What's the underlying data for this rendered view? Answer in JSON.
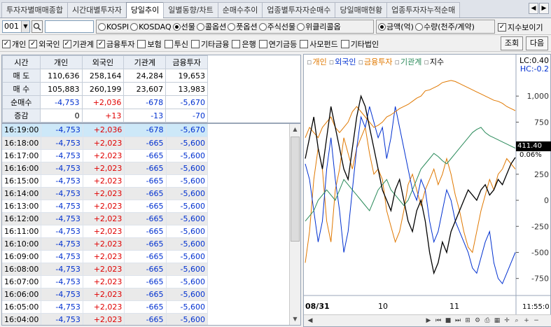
{
  "tabs": [
    {
      "label": "투자자별매매종합",
      "active": false
    },
    {
      "label": "시간대별투자자",
      "active": false
    },
    {
      "label": "당일추이",
      "active": true
    },
    {
      "label": "일별동향/차트",
      "active": false
    },
    {
      "label": "순매수추이",
      "active": false
    },
    {
      "label": "업종별투자자순매수",
      "active": false
    },
    {
      "label": "당일매매현황",
      "active": false
    },
    {
      "label": "업종투자자누적순매",
      "active": false
    }
  ],
  "filters": {
    "code": "001",
    "markets": [
      {
        "label": "KOSPI",
        "selected": false
      },
      {
        "label": "KOSDAQ",
        "selected": false
      },
      {
        "label": "선물",
        "selected": true
      },
      {
        "label": "콜옵션",
        "selected": false
      },
      {
        "label": "풋옵션",
        "selected": false
      },
      {
        "label": "주식선물",
        "selected": false
      },
      {
        "label": "위클리콜옵",
        "selected": false
      }
    ],
    "units": [
      {
        "label": "금액(억)",
        "selected": true
      },
      {
        "label": "수량(천주/계약)",
        "selected": false
      }
    ],
    "show_index_label": "지수보이기",
    "investors": [
      {
        "label": "개인",
        "checked": true
      },
      {
        "label": "외국인",
        "checked": true
      },
      {
        "label": "기관계",
        "checked": true
      },
      {
        "label": "금융투자",
        "checked": true
      },
      {
        "label": "보험",
        "checked": false
      },
      {
        "label": "투신",
        "checked": false
      },
      {
        "label": "기타금융",
        "checked": false
      },
      {
        "label": "은행",
        "checked": false
      },
      {
        "label": "연기금등",
        "checked": false
      },
      {
        "label": "사모펀드",
        "checked": false
      },
      {
        "label": "기타법인",
        "checked": false
      }
    ],
    "query_button": "조회",
    "next_button": "다음"
  },
  "summary": {
    "headers": [
      "시간",
      "개인",
      "외국인",
      "기관계",
      "금융투자"
    ],
    "rows": [
      {
        "label": "매 도",
        "values": [
          "110,636",
          "258,164",
          "24,284",
          "19,653"
        ],
        "color": [
          "",
          "",
          "",
          ""
        ]
      },
      {
        "label": "매 수",
        "values": [
          "105,883",
          "260,199",
          "23,607",
          "13,983"
        ],
        "color": [
          "",
          "",
          "",
          ""
        ]
      },
      {
        "label": "순매수",
        "values": [
          "-4,753",
          "+2,036",
          "-678",
          "-5,670"
        ],
        "color": [
          "blue",
          "red",
          "blue",
          "blue"
        ]
      },
      {
        "label": "증감",
        "values": [
          "0",
          "+13",
          "-13",
          "-70"
        ],
        "color": [
          "",
          "red",
          "blue",
          "blue"
        ]
      }
    ]
  },
  "timeline": [
    {
      "time": "16:19:00",
      "v": [
        "-4,753",
        "+2,036",
        "-678",
        "-5,670"
      ]
    },
    {
      "time": "16:18:00",
      "v": [
        "-4,753",
        "+2,023",
        "-665",
        "-5,600"
      ]
    },
    {
      "time": "16:17:00",
      "v": [
        "-4,753",
        "+2,023",
        "-665",
        "-5,600"
      ]
    },
    {
      "time": "16:16:00",
      "v": [
        "-4,753",
        "+2,023",
        "-665",
        "-5,600"
      ]
    },
    {
      "time": "16:15:00",
      "v": [
        "-4,753",
        "+2,023",
        "-665",
        "-5,600"
      ]
    },
    {
      "time": "16:14:00",
      "v": [
        "-4,753",
        "+2,023",
        "-665",
        "-5,600"
      ]
    },
    {
      "time": "16:13:00",
      "v": [
        "-4,753",
        "+2,023",
        "-665",
        "-5,600"
      ]
    },
    {
      "time": "16:12:00",
      "v": [
        "-4,753",
        "+2,023",
        "-665",
        "-5,600"
      ]
    },
    {
      "time": "16:11:00",
      "v": [
        "-4,753",
        "+2,023",
        "-665",
        "-5,600"
      ]
    },
    {
      "time": "16:10:00",
      "v": [
        "-4,753",
        "+2,023",
        "-665",
        "-5,600"
      ]
    },
    {
      "time": "16:09:00",
      "v": [
        "-4,753",
        "+2,023",
        "-665",
        "-5,600"
      ]
    },
    {
      "time": "16:08:00",
      "v": [
        "-4,753",
        "+2,023",
        "-665",
        "-5,600"
      ]
    },
    {
      "time": "16:07:00",
      "v": [
        "-4,753",
        "+2,023",
        "-665",
        "-5,600"
      ]
    },
    {
      "time": "16:06:00",
      "v": [
        "-4,753",
        "+2,023",
        "-665",
        "-5,600"
      ]
    },
    {
      "time": "16:05:00",
      "v": [
        "-4,753",
        "+2,023",
        "-665",
        "-5,600"
      ]
    },
    {
      "time": "16:04:00",
      "v": [
        "-4,753",
        "+2,023",
        "-665",
        "-5,600"
      ]
    }
  ],
  "chart": {
    "legend": [
      {
        "label": "개인",
        "color": "#e07800"
      },
      {
        "label": "외국인",
        "color": "#0030d0"
      },
      {
        "label": "금융투자",
        "color": "#e07800"
      },
      {
        "label": "기관계",
        "color": "#2a8a5a"
      },
      {
        "label": "지수",
        "color": "#000000"
      }
    ],
    "lc_label": "LC:0.40",
    "hc_label": "HC:-0.2",
    "y_ticks": [
      "1,000",
      "750",
      "500",
      "250",
      "0",
      "-250",
      "-500",
      "-750"
    ],
    "current_value": "411.40",
    "current_pct": "0.06%",
    "x_labels": [
      "08/31",
      "10",
      "11",
      "11:55:0"
    ]
  },
  "chart_data": {
    "type": "line",
    "title": "",
    "ylim": [
      -900,
      1250
    ],
    "y_ticks": [
      1000,
      750,
      500,
      250,
      0,
      -250,
      -500,
      -750
    ],
    "x_labels": [
      "08/31",
      "10",
      "11"
    ],
    "series": [
      {
        "name": "개인",
        "color": "#e07800",
        "values": [
          -600,
          -300,
          200,
          500,
          300,
          -200,
          -400,
          100,
          300,
          600,
          450,
          300,
          500,
          600,
          700,
          450,
          250,
          300,
          200,
          -100,
          -250,
          -400,
          -300,
          -100,
          150,
          250,
          100,
          -50,
          100,
          200,
          300,
          150,
          250,
          400,
          250,
          50,
          -100,
          -300,
          -450,
          -500,
          -300,
          -100,
          50,
          200,
          100,
          250,
          300,
          400,
          350,
          300
        ]
      },
      {
        "name": "외국인",
        "color": "#0030d0",
        "values": [
          350,
          200,
          -100,
          -400,
          -200,
          300,
          600,
          200,
          -100,
          -500,
          -300,
          100,
          500,
          800,
          700,
          900,
          750,
          600,
          700,
          400,
          600,
          900,
          700,
          500,
          300,
          100,
          0,
          200,
          100,
          -200,
          -400,
          -300,
          -100,
          100,
          0,
          -200,
          -300,
          -400,
          -500,
          -650,
          -700,
          -550,
          -400,
          -300,
          -600,
          -750,
          -800,
          -700,
          -600,
          -500
        ]
      },
      {
        "name": "금융투자",
        "color": "#e07800",
        "values": [
          600,
          700,
          650,
          600,
          700,
          750,
          800,
          700,
          650,
          700,
          750,
          850,
          900,
          850,
          800,
          750,
          700,
          720,
          750,
          800,
          820,
          850,
          880,
          900,
          920,
          950,
          980,
          1000,
          1050,
          1060,
          1080,
          1100,
          1130,
          1140,
          1150,
          1140,
          1120,
          1100,
          1080,
          1060,
          1040,
          1020,
          1000,
          980,
          960,
          950,
          930,
          900,
          880,
          860
        ]
      },
      {
        "name": "기관계",
        "color": "#2a8a5a",
        "values": [
          -200,
          -150,
          -100,
          0,
          50,
          100,
          50,
          0,
          100,
          200,
          150,
          100,
          50,
          0,
          -50,
          -100,
          0,
          100,
          150,
          200,
          100,
          50,
          0,
          -50,
          0,
          100,
          200,
          300,
          350,
          400,
          450,
          420,
          380,
          350,
          400,
          450,
          500,
          550,
          600,
          650,
          680,
          700,
          650,
          620,
          600,
          580,
          560,
          540,
          520,
          500
        ]
      },
      {
        "name": "지수",
        "color": "#000000",
        "values": [
          400,
          600,
          800,
          500,
          300,
          600,
          900,
          700,
          500,
          300,
          200,
          500,
          800,
          1000,
          900,
          700,
          500,
          300,
          100,
          0,
          -100,
          100,
          200,
          0,
          -200,
          -300,
          -100,
          0,
          -200,
          -500,
          -700,
          -600,
          -400,
          -500,
          -300,
          -200,
          -100,
          0,
          100,
          50,
          0,
          100,
          150,
          50,
          100,
          200,
          150,
          250,
          350,
          411
        ]
      }
    ]
  }
}
